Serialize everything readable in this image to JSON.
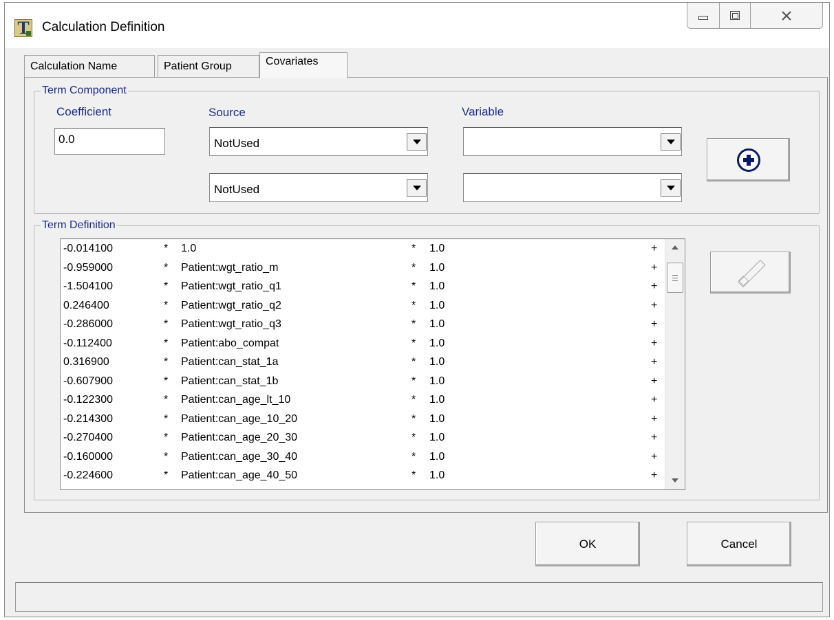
{
  "window": {
    "title": "Calculation Definition",
    "icon": "app-logo-icon"
  },
  "tabs": [
    {
      "label": "Calculation Name",
      "active": false
    },
    {
      "label": "Patient Group",
      "active": false
    },
    {
      "label": "Covariates",
      "active": true
    }
  ],
  "term_component": {
    "group_label": "Term Component",
    "coefficient_label": "Coefficient",
    "coefficient_value": "0.0",
    "source_label": "Source",
    "variable_label": "Variable",
    "source_1": "NotUsed",
    "source_2": "NotUsed",
    "variable_1": "",
    "variable_2": "",
    "add_icon": "plus-circle-icon"
  },
  "term_definition": {
    "group_label": "Term Definition",
    "rows": [
      {
        "coef": "-0.014100",
        "star1": "*",
        "term": "1.0",
        "star2": "*",
        "mult": "1.0",
        "plus": "+"
      },
      {
        "coef": "-0.959000",
        "star1": "*",
        "term": "Patient:wgt_ratio_m",
        "star2": "*",
        "mult": "1.0",
        "plus": "+"
      },
      {
        "coef": "-1.504100",
        "star1": "*",
        "term": "Patient:wgt_ratio_q1",
        "star2": "*",
        "mult": "1.0",
        "plus": "+"
      },
      {
        "coef": "0.246400",
        "star1": "*",
        "term": "Patient:wgt_ratio_q2",
        "star2": "*",
        "mult": "1.0",
        "plus": "+"
      },
      {
        "coef": "-0.286000",
        "star1": "*",
        "term": "Patient:wgt_ratio_q3",
        "star2": "*",
        "mult": "1.0",
        "plus": "+"
      },
      {
        "coef": "-0.112400",
        "star1": "*",
        "term": "Patient:abo_compat",
        "star2": "*",
        "mult": "1.0",
        "plus": "+"
      },
      {
        "coef": "0.316900",
        "star1": "*",
        "term": "Patient:can_stat_1a",
        "star2": "*",
        "mult": "1.0",
        "plus": "+"
      },
      {
        "coef": "-0.607900",
        "star1": "*",
        "term": "Patient:can_stat_1b",
        "star2": "*",
        "mult": "1.0",
        "plus": "+"
      },
      {
        "coef": "-0.122300",
        "star1": "*",
        "term": "Patient:can_age_lt_10",
        "star2": "*",
        "mult": "1.0",
        "plus": "+"
      },
      {
        "coef": "-0.214300",
        "star1": "*",
        "term": "Patient:can_age_10_20",
        "star2": "*",
        "mult": "1.0",
        "plus": "+"
      },
      {
        "coef": "-0.270400",
        "star1": "*",
        "term": "Patient:can_age_20_30",
        "star2": "*",
        "mult": "1.0",
        "plus": "+"
      },
      {
        "coef": "-0.160000",
        "star1": "*",
        "term": "Patient:can_age_30_40",
        "star2": "*",
        "mult": "1.0",
        "plus": "+"
      },
      {
        "coef": "-0.224600",
        "star1": "*",
        "term": "Patient:can_age_40_50",
        "star2": "*",
        "mult": "1.0",
        "plus": "+"
      }
    ],
    "delete_icon": "eraser-icon"
  },
  "buttons": {
    "ok_label": "OK",
    "cancel_label": "Cancel"
  }
}
